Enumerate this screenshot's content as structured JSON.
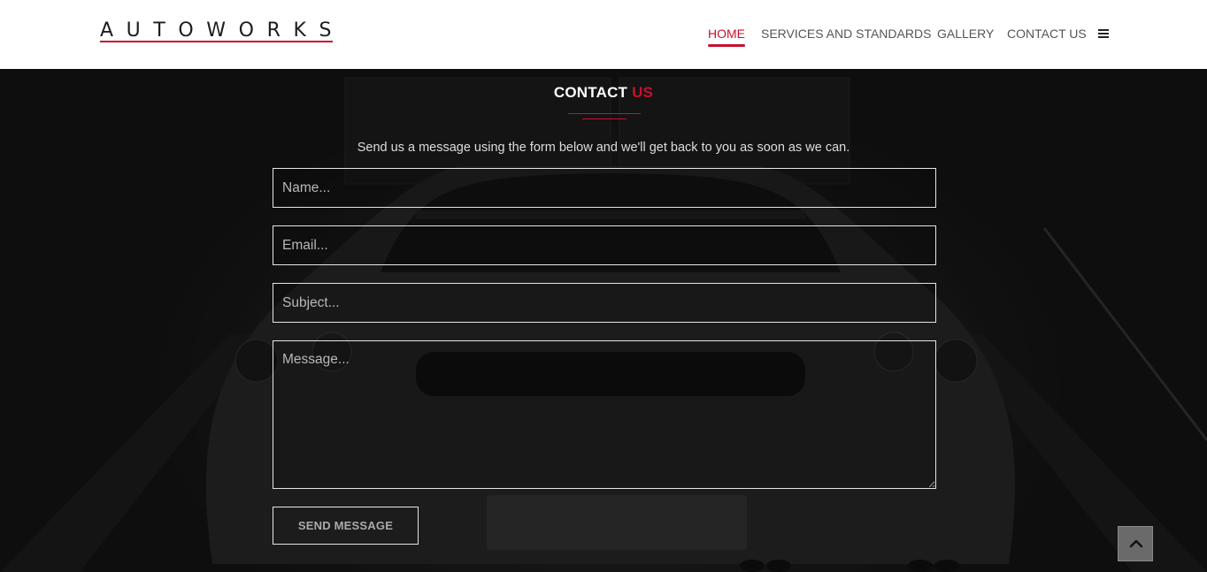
{
  "header": {
    "logo_text": "AUTOWORKS",
    "nav": [
      {
        "label": "HOME",
        "active": true
      },
      {
        "label": "SERVICES AND STANDARDS",
        "active": false
      },
      {
        "label": "GALLERY",
        "active": false
      },
      {
        "label": "CONTACT US",
        "active": false
      }
    ],
    "menu_icon": "hamburger-icon"
  },
  "contact": {
    "title_main": "CONTACT",
    "title_accent": "US",
    "intro": "Send us a message using the form below and we'll get back to you as soon as we can.",
    "fields": {
      "name_placeholder": "Name...",
      "email_placeholder": "Email...",
      "subject_placeholder": "Subject...",
      "message_placeholder": "Message..."
    },
    "send_label": "SEND MESSAGE"
  },
  "scroll_top_icon": "chevron-up-icon",
  "colors": {
    "accent": "#c8102e",
    "header_bg": "#ffffff",
    "nav_text": "#555555",
    "page_bg": "#1a1a1a"
  }
}
